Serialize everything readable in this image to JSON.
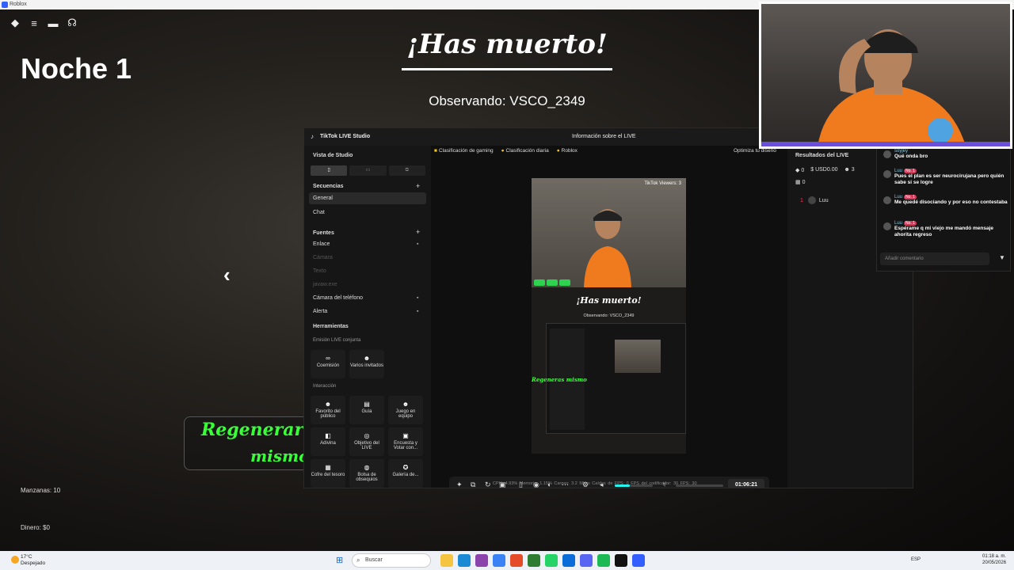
{
  "window": {
    "title": "Roblox"
  },
  "roblox_menu": {
    "icons": [
      "roblox-logo-icon",
      "menu-icon",
      "chat-icon",
      "headset-icon"
    ]
  },
  "game": {
    "night": "Noche 1",
    "death_title": "¡Has muerto!",
    "spectating": "Observando: VSCO_2349",
    "back_arrow": "‹",
    "regen_line1": "Regenerarse",
    "regen_line2": "mismo",
    "apples": "Manzanas: 10",
    "money": "Dinero: $0"
  },
  "tiktok": {
    "app_title": "TikTok LIVE Studio",
    "live_info": "Información sobre el LIVE",
    "sidebar": {
      "vista": "Vista de Studio",
      "sequences_header": "Secuencias",
      "sequences": [
        "General",
        "Chat"
      ],
      "sources_header": "Fuentes",
      "sources": [
        {
          "label": "Enlace",
          "enabled": true
        },
        {
          "label": "Cámara",
          "enabled": false
        },
        {
          "label": "Texto",
          "enabled": false
        },
        {
          "label": "javaw.exe",
          "enabled": false
        },
        {
          "label": "Cámara del teléfono",
          "enabled": true
        },
        {
          "label": "Alerta",
          "enabled": true
        }
      ],
      "tools_header": "Herramientas",
      "joint_live": "Emisión LIVE conjunta",
      "tools_joint": [
        "Coemisión",
        "Varios invitados"
      ],
      "interaction": "Interacción",
      "tools_interaction": [
        "Favorito del público",
        "Guía",
        "Juego en equipo",
        "Adivina",
        "Objetivo del LIVE",
        "Encuesta y Votar con...",
        "Cofre del tesoro",
        "Bolsa de obsequios",
        "Galería de..."
      ]
    },
    "chips": [
      "Clasificación de gaming",
      "Clasificación diaria",
      "Roblox"
    ],
    "optimize": "Optimiza tu diseño",
    "preview": {
      "viewers": "TikTok Viewers: 3",
      "death_title": "¡Has muerto!",
      "spectating": "Observando: VSCO_2349",
      "regen": "Regeneras mismo"
    },
    "controls": {
      "timer": "01:06:21",
      "volume": 0.4
    },
    "stats": "CPU: 4.93%   Memoria: 1.15%   Cargas: 3.2 Mbps   Caídas de FPS: 0   FPS del codificador: 30   FPS: 30",
    "results": {
      "header": "Resultados del LIVE",
      "coins": "0",
      "usd": "USD0.00",
      "viewers": "3",
      "gifts": "0",
      "rank": "1",
      "top_user": "Luu"
    }
  },
  "chat": {
    "messages": [
      {
        "user": "soyjey",
        "badge": "",
        "text": "Qué onda bro"
      },
      {
        "user": "Luu",
        "badge": "No. 1",
        "text": "Pues el plan es ser neurocirujana pero quién sabe si se logre"
      },
      {
        "user": "Luu",
        "badge": "No. 1",
        "text": "Me quedé disociando y por eso no contestaba"
      },
      {
        "user": "Luu",
        "badge": "No. 1",
        "text": "Espérame q mi viejo me mandó mensaje ahorita regreso"
      }
    ],
    "input_placeholder": "Añadir comentario"
  },
  "taskbar": {
    "weather_temp": "17°C",
    "weather_desc": "Despejado",
    "search": "Buscar",
    "lang": "ESP",
    "time": "01:18 a. m.",
    "date": "20/05/2026"
  },
  "colors": {
    "accent_green": "#39ff39",
    "tiktok_red": "#fe2c55",
    "tiktok_cyan": "#25f4ee"
  }
}
